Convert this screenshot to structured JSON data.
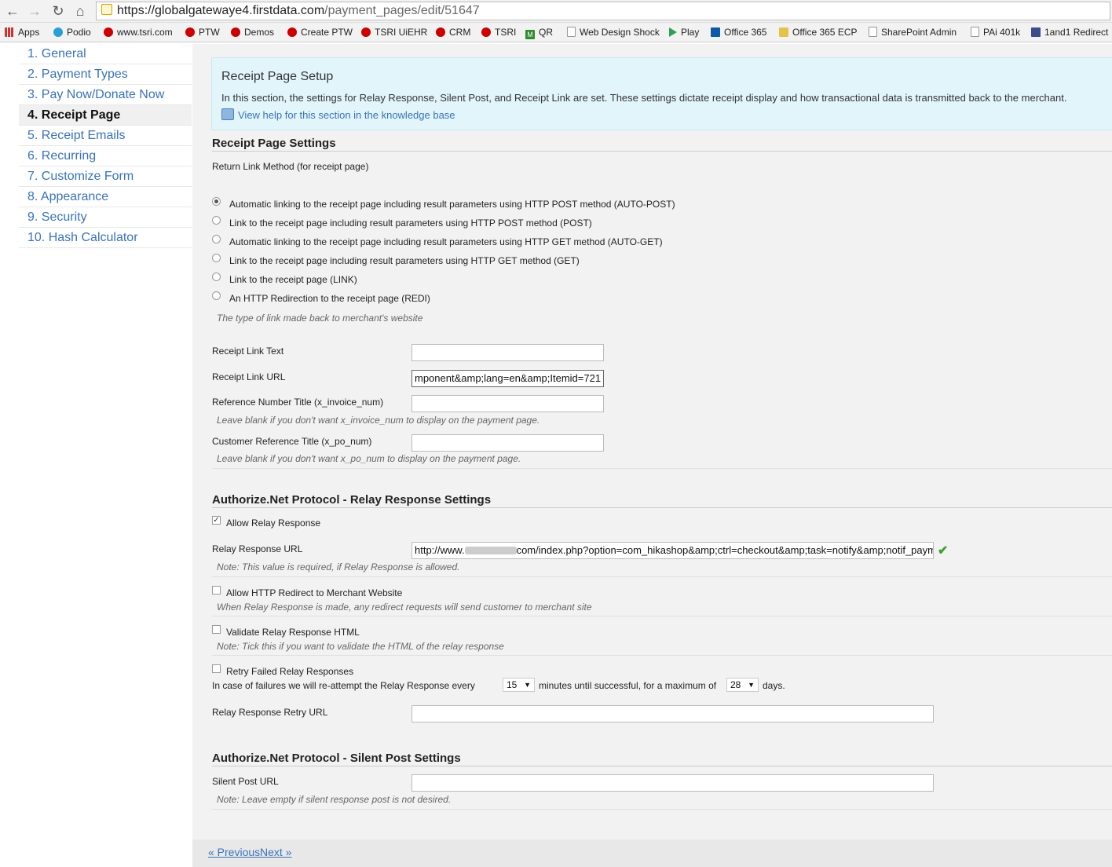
{
  "browser": {
    "url_host": "https://globalgatewaye4.firstdata.com",
    "url_path": "/payment_pages/edit/51647",
    "bookmarks": [
      "Apps",
      "Podio",
      "www.tsri.com",
      "PTW",
      "Demos",
      "Create PTW",
      "TSRI UiEHR",
      "CRM",
      "TSRI",
      "QR",
      "Web Design Shock",
      "Play",
      "Office 365",
      "Office 365 ECP",
      "SharePoint Admin",
      "PAi 401k",
      "1and1 Redirect"
    ]
  },
  "sidebar": {
    "items": [
      "1. General",
      "2. Payment Types",
      "3. Pay Now/Donate Now",
      "4. Receipt Page",
      "5. Receipt Emails",
      "6. Recurring",
      "7. Customize Form",
      "8. Appearance",
      "9. Security",
      "10. Hash Calculator"
    ],
    "active_index": 3
  },
  "panel": {
    "title": "Receipt Page Setup",
    "description": "In this section, the settings for Relay Response, Silent Post, and Receipt Link are set. These settings dictate receipt display and how transactional data is transmitted back to the merchant.",
    "help_link": "View help for this section in the knowledge base"
  },
  "receipt_settings": {
    "heading": "Receipt Page Settings",
    "return_method_label": "Return Link Method (for receipt page)",
    "options": [
      "Automatic linking to the receipt page including result parameters using HTTP POST method (AUTO-POST)",
      "Link to the receipt page including result parameters using HTTP POST method (POST)",
      "Automatic linking to the receipt page including result parameters using HTTP GET method (AUTO-GET)",
      "Link to the receipt page including result parameters using HTTP GET method (GET)",
      "Link to the receipt page (LINK)",
      "An HTTP Redirection to the receipt page (REDI)"
    ],
    "selected_option_index": 0,
    "options_note": "The type of link made back to merchant's website",
    "link_text_label": "Receipt Link Text",
    "link_text_value": "",
    "link_url_label": "Receipt Link URL",
    "link_url_value": "mponent&amp;lang=en&amp;Itemid=721",
    "ref_title_label": "Reference Number Title (x_invoice_num)",
    "ref_title_value": "",
    "ref_title_note": "Leave blank if you don't want x_invoice_num to display on the payment page.",
    "cust_ref_label": "Customer Reference Title (x_po_num)",
    "cust_ref_value": "",
    "cust_ref_note": "Leave blank if you don't want x_po_num to display on the payment page."
  },
  "relay": {
    "heading": "Authorize.Net Protocol - Relay Response Settings",
    "allow_label": "Allow Relay Response",
    "allow_checked": true,
    "url_label": "Relay Response URL",
    "url_value_prefix": "http://www.",
    "url_value_suffix": "com/index.php?option=com_hikashop&amp;ctrl=checkout&amp;task=notify&amp;notif_payme",
    "url_note": "Note: This value is required, if Relay Response is allowed.",
    "redirect_label": "Allow HTTP Redirect to Merchant Website",
    "redirect_note": "When Relay Response is made, any redirect requests will send customer to merchant site",
    "validate_label": "Validate Relay Response HTML",
    "validate_note": "Note: Tick this if you want to validate the HTML of the relay response",
    "retry_label": "Retry Failed Relay Responses",
    "retry_sentence_1": "In case of failures we will re-attempt the Relay Response every",
    "retry_minutes": "15",
    "retry_sentence_2": "minutes until successful, for a maximum of",
    "retry_days": "28",
    "retry_sentence_3": "days.",
    "retry_url_label": "Relay Response Retry URL",
    "retry_url_value": ""
  },
  "silent": {
    "heading": "Authorize.Net Protocol - Silent Post Settings",
    "url_label": "Silent Post URL",
    "url_value": "",
    "note": "Note: Leave empty if silent response post is not desired."
  },
  "pager": {
    "previous": "« Previous",
    "next": "Next »"
  },
  "colors": {
    "link": "#3a72b8",
    "panel_bg": "#e2f5fb",
    "valid_check": "#3aa32a"
  }
}
